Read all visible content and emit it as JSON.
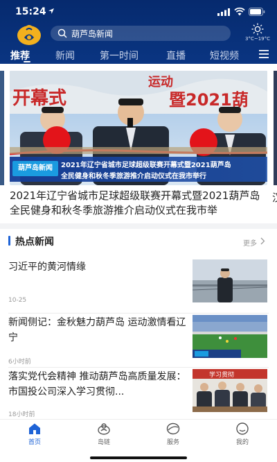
{
  "status_bar": {
    "time": "15:24",
    "icons": [
      "location-arrow-icon",
      "signal-icon",
      "wifi-icon",
      "battery-icon"
    ]
  },
  "header": {
    "logo_icon": "huludao-logo-icon",
    "search": {
      "text": "葫芦岛新闻",
      "icon": "search-icon"
    },
    "weather": {
      "icon": "sun-icon",
      "temp": "3°C~19°C"
    },
    "colors": {
      "background": "#0a3582",
      "accent": "#1e63d6"
    }
  },
  "nav": {
    "tabs": [
      {
        "label": "推荐",
        "active": true
      },
      {
        "label": "新闻",
        "active": false
      },
      {
        "label": "第一时间",
        "active": false
      },
      {
        "label": "直播",
        "active": false
      },
      {
        "label": "短视频",
        "active": false
      }
    ],
    "menu_icon": "hamburger-menu-icon"
  },
  "carousel": {
    "caption_logo": "葫芦岛新闻",
    "caption_line1": "2021年辽宁省城市足球超级联赛开幕式暨2021葫芦岛",
    "caption_line2": "全民健身和秋冬季旅游推介启动仪式在我市举行",
    "title": "2021年辽宁省城市足球超级联赛开幕式暨2021葫芦岛全民健身和秋冬季旅游推介启动仪式在我市举",
    "peek_next_title": "汉"
  },
  "hot_news": {
    "title": "热点新闻",
    "more": "更多",
    "items": [
      {
        "title": "习近平的黄河情缘",
        "meta": "10-25"
      },
      {
        "title": "新闻侧记：金秋魅力葫芦岛 运动激情看辽宁",
        "meta": "6小时前"
      },
      {
        "title": "落实党代会精神 推动葫芦岛高质量发展：市国投公司深入学习贯彻...",
        "meta": "18小时前"
      }
    ]
  },
  "tabbar": {
    "tabs": [
      {
        "label": "首页",
        "icon": "home-icon",
        "active": true
      },
      {
        "label": "岛链",
        "icon": "island-link-icon",
        "active": false
      },
      {
        "label": "服务",
        "icon": "service-icon",
        "active": false
      },
      {
        "label": "我的",
        "icon": "profile-icon",
        "active": false
      }
    ]
  }
}
